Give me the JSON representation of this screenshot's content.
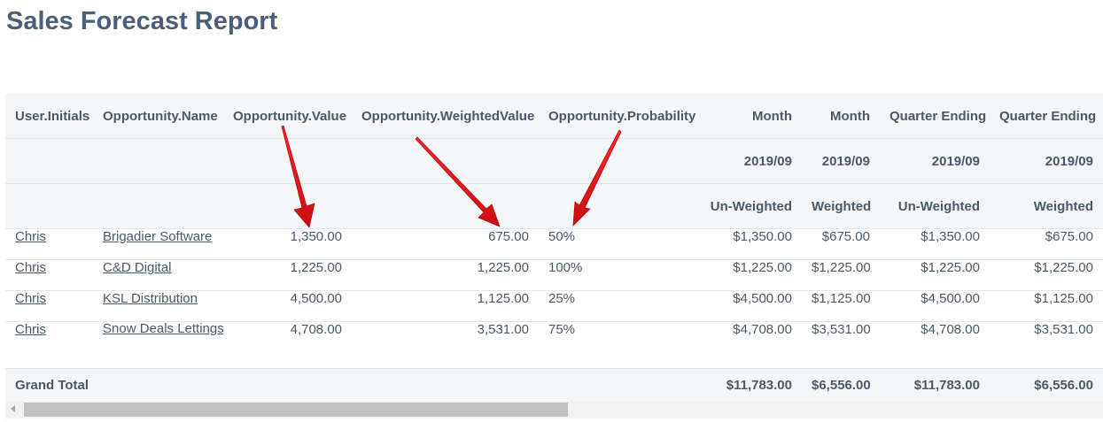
{
  "page": {
    "title": "Sales Forecast Report"
  },
  "table": {
    "header_row1": [
      "User.Initials",
      "Opportunity.Name",
      "Opportunity.Value",
      "Opportunity.WeightedValue",
      "Opportunity.Probability",
      "Month",
      "Month",
      "Quarter Ending",
      "Quarter Ending"
    ],
    "header_row2": [
      "",
      "",
      "",
      "",
      "",
      "2019/09",
      "2019/09",
      "2019/09",
      "2019/09"
    ],
    "header_row3": [
      "",
      "",
      "",
      "",
      "",
      "Un-Weighted",
      "Weighted",
      "Un-Weighted",
      "Weighted"
    ],
    "rows": [
      {
        "user": "Chris",
        "name": "Brigadier Software",
        "value": "1,350.00",
        "weighted": "675.00",
        "probability": "50%",
        "m_unweighted": "$1,350.00",
        "m_weighted": "$675.00",
        "q_unweighted": "$1,350.00",
        "q_weighted": "$675.00"
      },
      {
        "user": "Chris",
        "name": "C&D Digital",
        "value": "1,225.00",
        "weighted": "1,225.00",
        "probability": "100%",
        "m_unweighted": "$1,225.00",
        "m_weighted": "$1,225.00",
        "q_unweighted": "$1,225.00",
        "q_weighted": "$1,225.00"
      },
      {
        "user": "Chris",
        "name": "KSL Distribution",
        "value": "4,500.00",
        "weighted": "1,125.00",
        "probability": "25%",
        "m_unweighted": "$4,500.00",
        "m_weighted": "$1,125.00",
        "q_unweighted": "$4,500.00",
        "q_weighted": "$1,125.00"
      },
      {
        "user": "Chris",
        "name": "Snow Deals Lettings",
        "value": "4,708.00",
        "weighted": "3,531.00",
        "probability": "75%",
        "m_unweighted": "$4,708.00",
        "m_weighted": "$3,531.00",
        "q_unweighted": "$4,708.00",
        "q_weighted": "$3,531.00"
      }
    ],
    "total": {
      "label": "Grand Total",
      "m_unweighted": "$11,783.00",
      "m_weighted": "$6,556.00",
      "q_unweighted": "$11,783.00",
      "q_weighted": "$6,556.00"
    }
  },
  "annotation": {
    "arrow_color": "#e0141a"
  },
  "scrollbar": {
    "position": 0
  }
}
